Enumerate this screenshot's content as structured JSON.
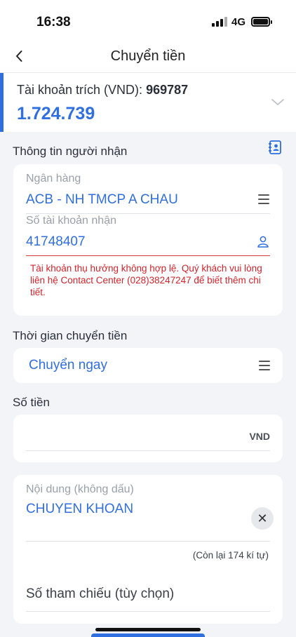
{
  "status_bar": {
    "time": "16:38",
    "network": "4G"
  },
  "header": {
    "title": "Chuyển tiền"
  },
  "source_account": {
    "label": "Tài khoản trích (VND): ",
    "number": "969787",
    "balance": "1.724.739"
  },
  "recipient": {
    "section_label": "Thông tin người nhận",
    "bank_label": "Ngân hàng",
    "bank_value": "ACB - NH TMCP A CHAU",
    "account_label": "Số tài khoản nhận",
    "account_value": "41748407",
    "error_message": "Tài khoản thụ hưởng không hợp lệ. Quý khách vui lòng liên hệ Contact Center (028)38247247 để biết thêm chi tiết."
  },
  "transfer_time": {
    "section_label": "Thời gian chuyển tiền",
    "value": "Chuyển ngay"
  },
  "amount": {
    "section_label": "Số tiền",
    "currency": "VND",
    "value": ""
  },
  "content": {
    "label": "Nội dung (không dấu)",
    "value": "CHUYEN KHOAN",
    "remaining": "(Còn lại 174 kí tự)",
    "reference_placeholder": "Số tham chiếu (tùy chọn)"
  },
  "colors": {
    "accent": "#2f6fe0",
    "error": "#d4232a",
    "background": "#f2f4f8"
  },
  "icons": [
    "back-icon",
    "chevron-down-icon",
    "contact-book-icon",
    "menu-icon",
    "person-icon",
    "close-icon"
  ]
}
